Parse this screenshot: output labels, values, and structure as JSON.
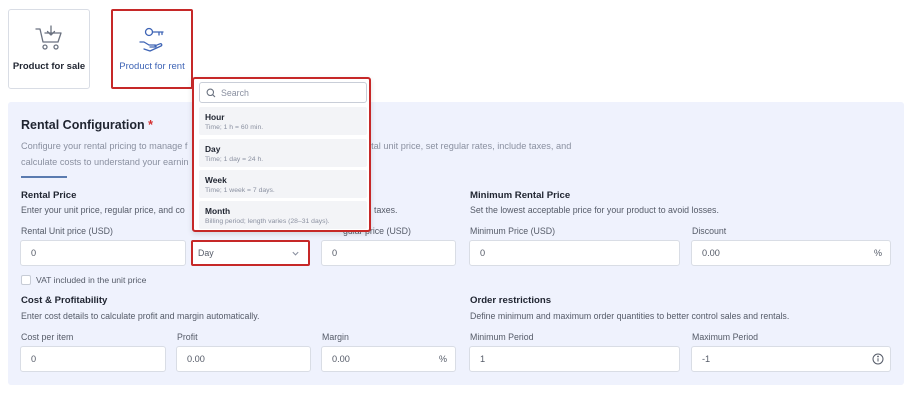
{
  "product_types": [
    {
      "label": "Product for sale",
      "icon": "shopping-cart-download-icon",
      "selected": false
    },
    {
      "label": "Product for rent",
      "icon": "hand-key-icon",
      "selected": true
    }
  ],
  "config": {
    "title": "Rental Configuration",
    "required_mark": "*",
    "description_line1_a": "Configure your rental pricing to manage f",
    "description_line1_b": "ntal unit price, set regular rates, include taxes, and",
    "description_line2": "calculate costs to understand your earnin"
  },
  "rental_price": {
    "title": "Rental Price",
    "subtitle_a": "Enter your unit price, regular price, and co",
    "subtitle_b": "taxes.",
    "unit_price_label": "Rental Unit price (USD)",
    "unit_price_value": "0",
    "unit_select_value": "Day",
    "regular_price_label_fragment": "gular price (USD)",
    "regular_price_value": "0",
    "vat_label": "VAT included in the unit price",
    "vat_checked": false
  },
  "minimum_rental": {
    "title": "Minimum Rental Price",
    "subtitle": "Set the lowest acceptable price for your product to avoid losses.",
    "min_price_label": "Minimum Price (USD)",
    "min_price_value": "0",
    "discount_label": "Discount",
    "discount_value": "0.00",
    "discount_suffix": "%"
  },
  "cost": {
    "title": "Cost & Profitability",
    "subtitle": "Enter cost details to calculate profit and margin automatically.",
    "cost_label": "Cost per item",
    "cost_value": "0",
    "profit_label": "Profit",
    "profit_value": "0.00",
    "margin_label": "Margin",
    "margin_value": "0.00",
    "margin_suffix": "%"
  },
  "order_restrictions": {
    "title": "Order restrictions",
    "subtitle": "Define minimum and maximum order quantities to better control sales and rentals.",
    "min_period_label": "Minimum Period",
    "min_period_value": "1",
    "max_period_label": "Maximum Period",
    "max_period_value": "-1"
  },
  "dropdown": {
    "search_placeholder": "Search",
    "options": [
      {
        "title": "Hour",
        "desc": "Time; 1 h = 60 min."
      },
      {
        "title": "Day",
        "desc": "Time; 1 day = 24 h."
      },
      {
        "title": "Week",
        "desc": "Time; 1 week = 7 days."
      },
      {
        "title": "Month",
        "desc": "Billing period; length varies (28–31 days)."
      }
    ]
  },
  "colors": {
    "accent": "#3e64b5",
    "highlight": "#c62828",
    "panel_bg": "#eff2fd"
  }
}
